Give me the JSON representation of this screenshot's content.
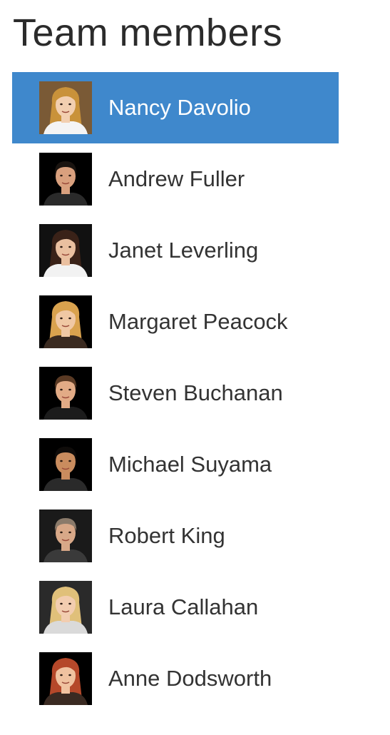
{
  "header": {
    "title": "Team members"
  },
  "colors": {
    "selected_background": "#3f88cc",
    "selected_text": "#ffffff",
    "text": "#333333"
  },
  "members": [
    {
      "name": "Nancy Davolio",
      "selected": true,
      "avatar_icon": "woman-portrait-icon",
      "skin": "#f2cfb0",
      "hair": "#c9923a",
      "bg": "#7a5a36",
      "shirt": "#f4f4f4"
    },
    {
      "name": "Andrew Fuller",
      "selected": false,
      "avatar_icon": "man-portrait-icon",
      "skin": "#d9a07e",
      "hair": "#1a1410",
      "bg": "#000000",
      "shirt": "#2a2a2a"
    },
    {
      "name": "Janet Leverling",
      "selected": false,
      "avatar_icon": "woman-portrait-icon",
      "skin": "#eac0a0",
      "hair": "#3a2218",
      "bg": "#111111",
      "shirt": "#f2f2f2"
    },
    {
      "name": "Margaret Peacock",
      "selected": false,
      "avatar_icon": "woman-portrait-icon",
      "skin": "#f0c8a4",
      "hair": "#d9a24e",
      "bg": "#000000",
      "shirt": "#3a2a20"
    },
    {
      "name": "Steven Buchanan",
      "selected": false,
      "avatar_icon": "man-portrait-icon",
      "skin": "#e2ab86",
      "hair": "#5a3a24",
      "bg": "#000000",
      "shirt": "#1c1c1c"
    },
    {
      "name": "Michael Suyama",
      "selected": false,
      "avatar_icon": "man-portrait-icon",
      "skin": "#c98c5e",
      "hair": "#0f0c0a",
      "bg": "#000000",
      "shirt": "#2a2a2a"
    },
    {
      "name": "Robert King",
      "selected": false,
      "avatar_icon": "man-portrait-icon",
      "skin": "#d8a888",
      "hair": "#8a7a6a",
      "bg": "#1a1a1a",
      "shirt": "#3a3a3a"
    },
    {
      "name": "Laura Callahan",
      "selected": false,
      "avatar_icon": "woman-portrait-icon",
      "skin": "#f2cdb0",
      "hair": "#e0c07a",
      "bg": "#2a2a2a",
      "shirt": "#dadada"
    },
    {
      "name": "Anne Dodsworth",
      "selected": false,
      "avatar_icon": "woman-portrait-icon",
      "skin": "#f0c2a0",
      "hair": "#b5482a",
      "bg": "#000000",
      "shirt": "#3a2a22"
    }
  ]
}
